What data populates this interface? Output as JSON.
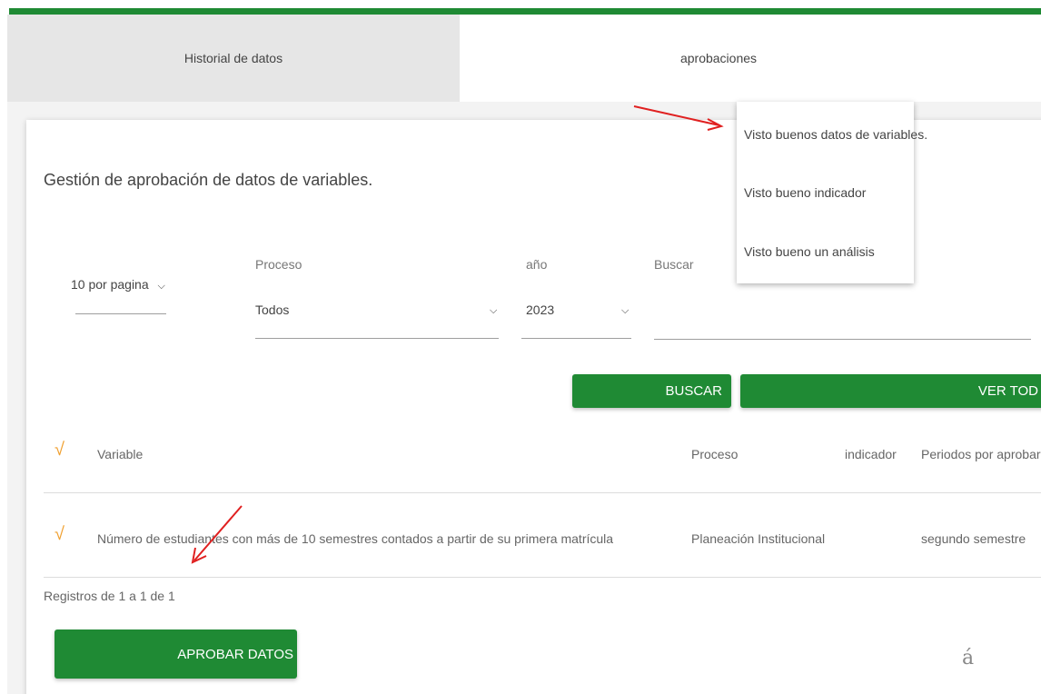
{
  "tabs": {
    "historial": "Historial de datos",
    "aprobaciones": "aprobaciones"
  },
  "dropdown_menu": {
    "items": [
      "Visto buenos datos de variables.",
      "Visto bueno indicador",
      "Visto bueno un análisis"
    ]
  },
  "page": {
    "title": "Gestión de aprobación de datos de variables."
  },
  "filters": {
    "per_page": "10 por pagina",
    "proceso_label": "Proceso",
    "proceso_value": "Todos",
    "anio_label": "año",
    "anio_value": "2023",
    "buscar_label": "Buscar",
    "buscar_value": ""
  },
  "buttons": {
    "buscar": "BUSCAR",
    "ver_todo": "VER TOD",
    "aprobar": "APROBAR DATOS"
  },
  "table": {
    "headers": {
      "variable": "Variable",
      "proceso": "Proceso",
      "indicador": "indicador",
      "periodos": "Periodos por aprobar"
    },
    "rows": [
      {
        "variable": "Número de estudiantes con más de 10 semestres contados a partir de su primera matrícula",
        "proceso": "Planeación Institucional",
        "periodos": "segundo semestre"
      }
    ]
  },
  "footer": {
    "records": "Registros de 1 a 1 de 1",
    "glyph": "á"
  },
  "colors": {
    "accent": "#1f8a34",
    "check": "#f0a030",
    "annotation_arrow": "#e02020"
  }
}
